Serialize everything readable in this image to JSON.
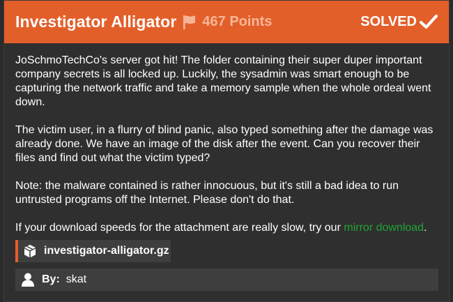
{
  "challenge": {
    "title": "Investigator Alligator",
    "points": "467 Points",
    "status": "SOLVED",
    "description": [
      "JoSchmoTechCo's server got hit! The folder containing their super duper important company secrets is all locked up. Luckily, the sysadmin was smart enough to be capturing the network traffic and take a memory sample when the whole ordeal went down.",
      "The victim user, in a flurry of blind panic, also typed something after the damage was already done. We have an image of the disk after the event. Can you recover their files and find out what the victim typed?",
      "Note: the malware contained is rather innocuous, but it's still a bad idea to run untrusted programs off the Internet. Please don't do that."
    ],
    "download_note_prefix": "If your download speeds for the attachment are really slow, try our ",
    "mirror_link_text": "mirror download",
    "download_note_suffix": ".",
    "attachment": "investigator-alligator.gz",
    "author_label": "By:",
    "author": "skat"
  },
  "icons": {
    "flag": "flag-icon",
    "check": "check-icon",
    "attachment": "box-icon",
    "author": "user-icon"
  },
  "colors": {
    "header": "#e35f2a",
    "points": "#f6b598",
    "link": "#1fa534",
    "panel": "#3e3e3e",
    "background": "#2f2f2f"
  }
}
